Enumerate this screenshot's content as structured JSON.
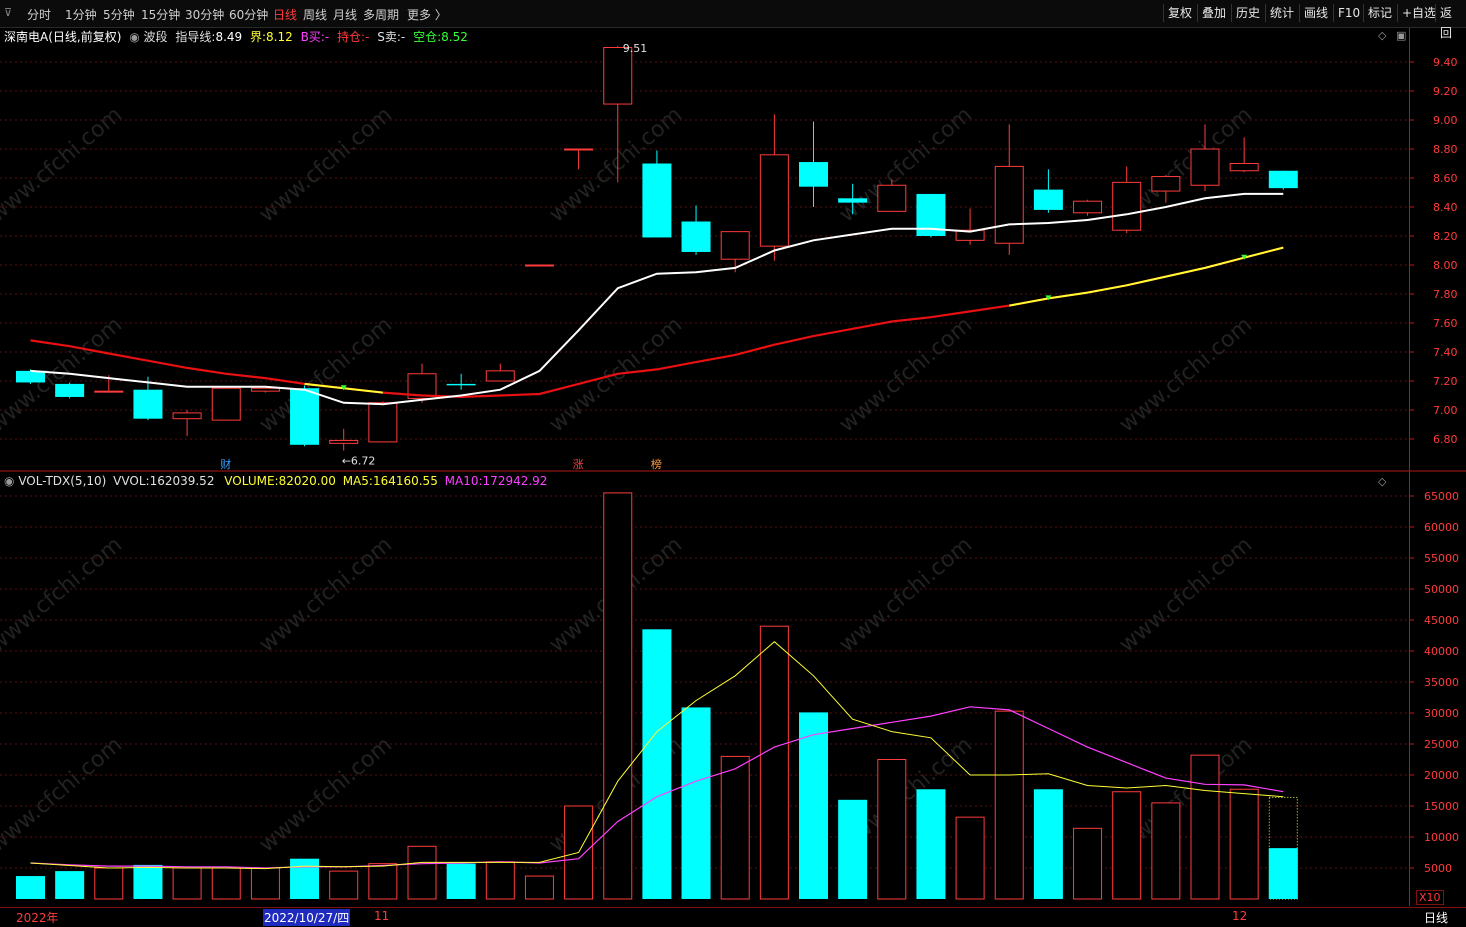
{
  "toolbar": {
    "left_items": [
      "分时",
      "1分钟",
      "5分钟",
      "15分钟",
      "30分钟",
      "60分钟",
      "日线",
      "周线",
      "月线",
      "多周期",
      "更多 〉"
    ],
    "active": "日线",
    "right_items": [
      "复权",
      "叠加",
      "历史",
      "统计",
      "画线",
      "F10",
      "标记",
      "+自选",
      "返回"
    ]
  },
  "price_panel": {
    "stock": "深南电A",
    "period_note": "(日线,前复权)",
    "indicator": "波段",
    "guide_label": "指导线:",
    "guide_value": "8.49",
    "jie_label": "界:",
    "jie_value": "8.12",
    "buy_label": "B买:",
    "buy_value": "-",
    "hold_label": "持仓:",
    "hold_value": "-",
    "sell_label": "S卖:",
    "sell_value": "-",
    "empty_label": "空仓:",
    "empty_value": "8.52",
    "high_label": "9.51",
    "low_label": "6.72",
    "event_markers": [
      {
        "text": "财",
        "bar": 5,
        "color": "#3aa0ff"
      },
      {
        "text": "涨",
        "bar": 14,
        "color": "#ff4040"
      },
      {
        "text": "榜",
        "bar": 16,
        "color": "#ff9a3a"
      }
    ]
  },
  "volume_panel": {
    "name": "VOL-TDX(5,10)",
    "vvol_label": "VVOL:",
    "vvol_value": "162039.52",
    "volume_label": "VOLUME:",
    "volume_value": "82020.00",
    "ma5_label": "MA5:",
    "ma5_value": "164160.55",
    "ma10_label": "MA10:",
    "ma10_value": "172942.92",
    "multiplier": "X10"
  },
  "date_axis": {
    "year": "2022年",
    "cursor_date": "2022/10/27/四",
    "month_11": "11",
    "month_12": "12",
    "period": "日线"
  },
  "watermark": "www.cfchi.com",
  "colors": {
    "up": "#ff3b3b",
    "down": "#00ffff",
    "ma_white": "#ffffff",
    "ma_red": "#e81010",
    "ma_yellow": "#ffff33",
    "vol_ma5": "#ffff33",
    "vol_ma10": "#ff40ff",
    "axis": "#c01818",
    "grid": "#5a1010"
  },
  "chart_data": {
    "type": "candlestick",
    "price_ticks": [
      6.8,
      7.0,
      7.2,
      7.4,
      7.6,
      7.8,
      8.0,
      8.2,
      8.4,
      8.6,
      8.8,
      9.0,
      9.2,
      9.4
    ],
    "volume_ticks": [
      5000,
      10000,
      15000,
      20000,
      25000,
      30000,
      35000,
      40000,
      45000,
      50000,
      55000,
      60000,
      65000
    ],
    "volume_unit_multiplier": 10,
    "candles": [
      {
        "o": 7.27,
        "h": 7.28,
        "l": 7.18,
        "c": 7.19,
        "v": 3700
      },
      {
        "o": 7.18,
        "h": 7.19,
        "l": 7.08,
        "c": 7.09,
        "v": 4500
      },
      {
        "o": 7.13,
        "h": 7.24,
        "l": 7.12,
        "c": 7.13,
        "v": 5000
      },
      {
        "o": 7.14,
        "h": 7.23,
        "l": 6.93,
        "c": 6.94,
        "v": 5500
      },
      {
        "o": 6.94,
        "h": 7.0,
        "l": 6.82,
        "c": 6.98,
        "v": 5000
      },
      {
        "o": 6.93,
        "h": 7.16,
        "l": 6.93,
        "c": 7.15,
        "v": 5000
      },
      {
        "o": 7.13,
        "h": 7.16,
        "l": 7.12,
        "c": 7.15,
        "v": 5000
      },
      {
        "o": 7.15,
        "h": 7.17,
        "l": 6.75,
        "c": 6.76,
        "v": 6500
      },
      {
        "o": 6.77,
        "h": 6.87,
        "l": 6.72,
        "c": 6.79,
        "v": 4500
      },
      {
        "o": 6.78,
        "h": 7.06,
        "l": 6.78,
        "c": 7.05,
        "v": 5700
      },
      {
        "o": 7.08,
        "h": 7.32,
        "l": 7.05,
        "c": 7.25,
        "v": 8500
      },
      {
        "o": 7.18,
        "h": 7.25,
        "l": 7.14,
        "c": 7.17,
        "v": 5700
      },
      {
        "o": 7.2,
        "h": 7.32,
        "l": 7.2,
        "c": 7.27,
        "v": 6000
      },
      {
        "o": 8.0,
        "h": 8.0,
        "l": 8.0,
        "c": 8.0,
        "v": 3700
      },
      {
        "o": 8.8,
        "h": 8.8,
        "l": 8.66,
        "c": 8.8,
        "v": 15000
      },
      {
        "o": 9.11,
        "h": 9.51,
        "l": 8.57,
        "c": 9.5,
        "v": 65500
      },
      {
        "o": 8.7,
        "h": 8.79,
        "l": 8.19,
        "c": 8.19,
        "v": 43500
      },
      {
        "o": 8.3,
        "h": 8.41,
        "l": 8.07,
        "c": 8.09,
        "v": 30900
      },
      {
        "o": 8.04,
        "h": 8.23,
        "l": 7.95,
        "c": 8.23,
        "v": 23000
      },
      {
        "o": 8.13,
        "h": 9.04,
        "l": 8.03,
        "c": 8.76,
        "v": 44000
      },
      {
        "o": 8.71,
        "h": 8.99,
        "l": 8.4,
        "c": 8.54,
        "v": 30100
      },
      {
        "o": 8.46,
        "h": 8.56,
        "l": 8.35,
        "c": 8.43,
        "v": 16000
      },
      {
        "o": 8.37,
        "h": 8.59,
        "l": 8.37,
        "c": 8.55,
        "v": 22500
      },
      {
        "o": 8.49,
        "h": 8.49,
        "l": 8.19,
        "c": 8.2,
        "v": 17700
      },
      {
        "o": 8.17,
        "h": 8.39,
        "l": 8.14,
        "c": 8.24,
        "v": 13200
      },
      {
        "o": 8.15,
        "h": 8.97,
        "l": 8.07,
        "c": 8.68,
        "v": 30300
      },
      {
        "o": 8.52,
        "h": 8.66,
        "l": 8.36,
        "c": 8.38,
        "v": 17700
      },
      {
        "o": 8.36,
        "h": 8.45,
        "l": 8.34,
        "c": 8.44,
        "v": 11400
      },
      {
        "o": 8.24,
        "h": 8.68,
        "l": 8.22,
        "c": 8.57,
        "v": 17300
      },
      {
        "o": 8.51,
        "h": 8.62,
        "l": 8.43,
        "c": 8.61,
        "v": 15500
      },
      {
        "o": 8.55,
        "h": 8.97,
        "l": 8.51,
        "c": 8.8,
        "v": 23200
      },
      {
        "o": 8.65,
        "h": 8.88,
        "l": 8.64,
        "c": 8.7,
        "v": 17700
      },
      {
        "o": 8.65,
        "h": 8.65,
        "l": 8.52,
        "c": 8.53,
        "v": 8202
      }
    ],
    "ma_white": [
      7.27,
      7.25,
      7.22,
      7.19,
      7.16,
      7.16,
      7.16,
      7.14,
      7.05,
      7.04,
      7.07,
      7.1,
      7.14,
      7.27,
      7.55,
      7.84,
      7.94,
      7.95,
      7.98,
      8.1,
      8.17,
      8.21,
      8.25,
      8.25,
      8.23,
      8.28,
      8.29,
      8.31,
      8.35,
      8.4,
      8.46,
      8.49,
      8.49
    ],
    "ma_jie": [
      7.48,
      7.44,
      7.39,
      7.34,
      7.29,
      7.25,
      7.22,
      7.18,
      7.15,
      7.12,
      7.1,
      7.09,
      7.1,
      7.11,
      7.18,
      7.25,
      7.28,
      7.33,
      7.38,
      7.45,
      7.51,
      7.56,
      7.61,
      7.64,
      7.68,
      7.72,
      7.77,
      7.81,
      7.86,
      7.92,
      7.98,
      8.05,
      8.12
    ],
    "ma_jie_yellow_ranges": [
      [
        7,
        9
      ],
      [
        25,
        32
      ]
    ],
    "vol_ma5": [
      5800,
      5400,
      5000,
      5100,
      5000,
      5000,
      4900,
      5300,
      5200,
      5300,
      5900,
      5900,
      5900,
      5900,
      7500,
      19000,
      27000,
      32000,
      36000,
      41500,
      36000,
      29000,
      27000,
      26000,
      20000,
      20000,
      20200,
      18300,
      17900,
      18300,
      17500,
      17000,
      16500
    ],
    "vol_ma10": [
      5800,
      5500,
      5300,
      5300,
      5200,
      5200,
      5000,
      5200,
      5200,
      5400,
      5700,
      5800,
      6000,
      5800,
      6500,
      12500,
      16500,
      19000,
      21000,
      24500,
      26500,
      27500,
      28500,
      29500,
      31000,
      30500,
      27500,
      24500,
      22000,
      19500,
      18500,
      18400,
      17300
    ]
  }
}
